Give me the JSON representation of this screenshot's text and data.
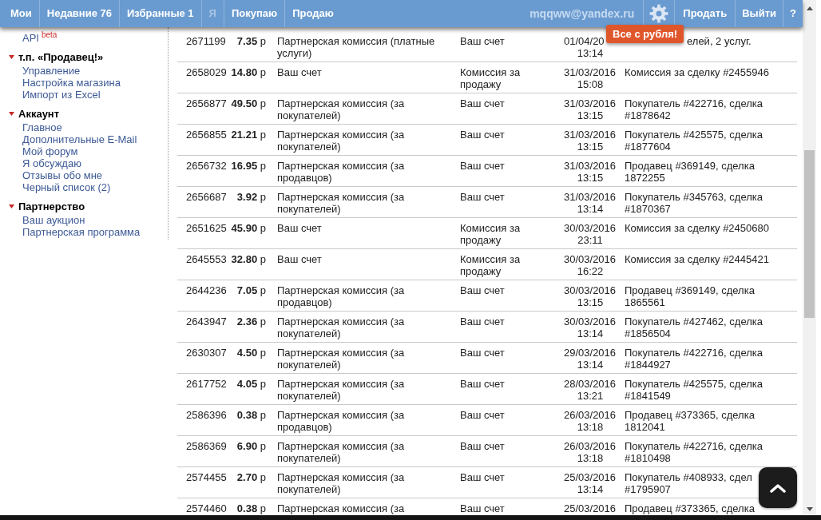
{
  "top_bar": {
    "nav": [
      {
        "label": "Мои",
        "disabled": false
      },
      {
        "label": "Недавние 76",
        "disabled": false
      },
      {
        "label": "Избранные 1",
        "disabled": false
      },
      {
        "label": "Я",
        "disabled": true
      },
      {
        "label": "Покупаю",
        "disabled": false
      },
      {
        "label": "Продаю",
        "disabled": false
      }
    ],
    "email": "mqqww@yandex.ru",
    "actions": [
      "Продать",
      "Выйти",
      "?"
    ]
  },
  "promo_badge": "Все с рубля!",
  "sidebar": {
    "links": [
      {
        "label": "API",
        "tag": "beta"
      }
    ],
    "sections": [
      {
        "title": "т.п. «Продавец!»",
        "expanded": true,
        "links": [
          "Управление",
          "Настройка магазина",
          "Импорт из Excel"
        ]
      },
      {
        "title": "Аккаунт",
        "expanded": true,
        "links": [
          "Главное",
          "Дополнительные E-Mail",
          "Мой форум",
          "Я обсуждаю",
          "Отзывы обо мне",
          "Черный список (2)"
        ]
      },
      {
        "title": "Партнерство",
        "expanded": true,
        "links": [
          "Ваш аукцион",
          "Партнерская программа"
        ]
      }
    ]
  },
  "table": {
    "rows": [
      {
        "cells": [
          "2671199",
          "**7.35** р",
          "Партнерская комиссия (платные услуги)",
          "Ваш счет",
          [
            "01/04/20",
            "13:14"
          ],
          "елей, 2 услуг."
        ]
      },
      {
        "cells": [
          "2658029",
          "**14.80** р",
          "Ваш счет",
          "Комиссия за продажу",
          [
            "31/03/2016",
            "15:08"
          ],
          "Комиссия за сделку #2455946"
        ]
      },
      {
        "cells": [
          "2656877",
          "**49.50** р",
          "Партнерская комиссия (за покупателей)",
          "Ваш счет",
          [
            "31/03/2016",
            "13:15"
          ],
          "Покупатель #422716, сделка #1878642"
        ]
      },
      {
        "cells": [
          "2656855",
          "**21.21** р",
          "Партнерская комиссия (за покупателей)",
          "Ваш счет",
          [
            "31/03/2016",
            "13:15"
          ],
          "Покупатель #425575, сделка #1877604"
        ]
      },
      {
        "cells": [
          "2656732",
          "**16.95** р",
          "Партнерская комиссия (за продавцов)",
          "Ваш счет",
          [
            "31/03/2016",
            "13:15"
          ],
          "Продавец #369149, сделка 1872255"
        ]
      },
      {
        "cells": [
          "2656687",
          "**3.92** р",
          "Партнерская комиссия (за покупателей)",
          "Ваш счет",
          [
            "31/03/2016",
            "13:14"
          ],
          "Покупатель #345763, сделка #1870367"
        ]
      },
      {
        "cells": [
          "2651625",
          "**45.90** р",
          "Ваш счет",
          "Комиссия за продажу",
          [
            "30/03/2016",
            "23:11"
          ],
          "Комиссия за сделку #2450680"
        ]
      },
      {
        "cells": [
          "2645553",
          "**32.80** р",
          "Ваш счет",
          "Комиссия за продажу",
          [
            "30/03/2016",
            "16:22"
          ],
          "Комиссия за сделку #2445421"
        ]
      },
      {
        "cells": [
          "2644236",
          "**7.05** р",
          "Партнерская комиссия (за продавцов)",
          "Ваш счет",
          [
            "30/03/2016",
            "13:15"
          ],
          "Продавец #369149, сделка 1865561"
        ]
      },
      {
        "cells": [
          "2643947",
          "**2.36** р",
          "Партнерская комиссия (за покупателей)",
          "Ваш счет",
          [
            "30/03/2016",
            "13:14"
          ],
          "Покупатель #427462, сделка #1856504"
        ]
      },
      {
        "cells": [
          "2630307",
          "**4.50** р",
          "Партнерская комиссия (за покупателей)",
          "Ваш счет",
          [
            "29/03/2016",
            "13:14"
          ],
          "Покупатель #422716, сделка #1844927"
        ]
      },
      {
        "cells": [
          "2617752",
          "**4.05** р",
          "Партнерская комиссия (за покупателей)",
          "Ваш счет",
          [
            "28/03/2016",
            "13:21"
          ],
          "Покупатель #425575, сделка #1841549"
        ]
      },
      {
        "cells": [
          "2586396",
          "**0.38** р",
          "Партнерская комиссия (за продавцов)",
          "Ваш счет",
          [
            "26/03/2016",
            "13:18"
          ],
          "Продавец #373365, сделка 1812041"
        ]
      },
      {
        "cells": [
          "2586369",
          "**6.90** р",
          "Партнерская комиссия (за покупателей)",
          "Ваш счет",
          [
            "26/03/2016",
            "13:18"
          ],
          "Покупатель #422716, сделка #1810498"
        ]
      },
      {
        "cells": [
          "2574455",
          "**2.70** р",
          "Партнерская комиссия (за покупателей)",
          "Ваш счет",
          [
            "25/03/2016",
            "13:14"
          ],
          "Покупатель #408933, сдел #1795907"
        ]
      },
      {
        "cells": [
          "2574460",
          "**0.38** р",
          "Партнерская комиссия (за",
          "Ваш счет",
          [
            "25/03/2016"
          ],
          "Продавец #373365, сделка"
        ]
      }
    ]
  }
}
